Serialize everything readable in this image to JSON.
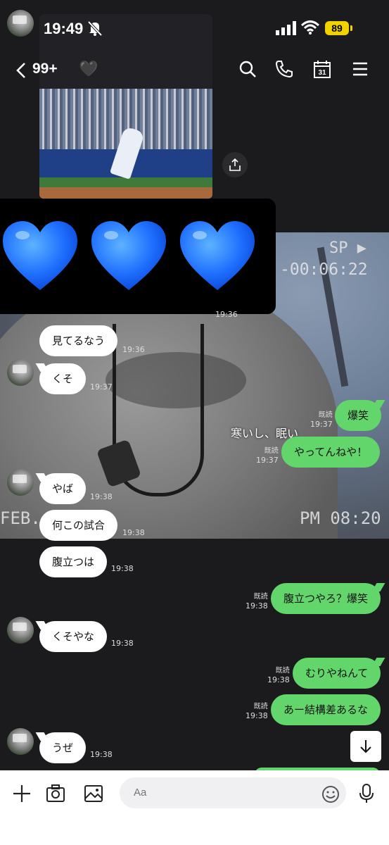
{
  "status_bar": {
    "time": "19:49",
    "battery": "89"
  },
  "header": {
    "unread_count": "99+",
    "chat_name_emoji": "🖤",
    "icons": [
      "back-icon",
      "search-icon",
      "phone-icon",
      "calendar-icon",
      "menu-icon"
    ],
    "calendar_day": "31"
  },
  "emoji_message": {
    "emoji": "💙💙💙",
    "time": "19:36"
  },
  "photo": {
    "vhs_sp": "SP ▶",
    "vhs_counter": "-00:06:22",
    "vhs_date": "FEB. 27",
    "vhs_pm": "PM 08:20",
    "caption": "寒いし、眠い"
  },
  "messages": [
    {
      "dir": "in",
      "text": "見てるなう",
      "time": "19:36",
      "read": ""
    },
    {
      "dir": "in",
      "text": "くそ",
      "time": "19:37",
      "read": ""
    },
    {
      "dir": "out",
      "text": "爆笑",
      "time": "19:37",
      "read": "既読"
    },
    {
      "dir": "out",
      "text": "やってんねや！",
      "time": "19:37",
      "read": "既読"
    },
    {
      "dir": "in",
      "text": "やば",
      "time": "19:38",
      "read": ""
    },
    {
      "dir": "in",
      "text": "何この試合",
      "time": "19:38",
      "read": ""
    },
    {
      "dir": "in",
      "text": "腹立つは",
      "time": "19:38",
      "read": ""
    },
    {
      "dir": "out",
      "text": "腹立つやろ？爆笑",
      "time": "19:38",
      "read": "既読"
    },
    {
      "dir": "in",
      "text": "くそやな",
      "time": "19:38",
      "read": ""
    },
    {
      "dir": "out",
      "text": "むりやねんて",
      "time": "19:38",
      "read": "既読"
    },
    {
      "dir": "out",
      "text": "あー結構差あるな",
      "time": "19:38",
      "read": "既読"
    },
    {
      "dir": "in",
      "text": "うぜ",
      "time": "19:38",
      "read": ""
    }
  ],
  "input": {
    "placeholder": "Aa"
  },
  "colors": {
    "sent_bubble": "#62d66b",
    "received_bubble": "#ffffff",
    "battery": "#f0d200",
    "background": "#1b1b1d"
  }
}
